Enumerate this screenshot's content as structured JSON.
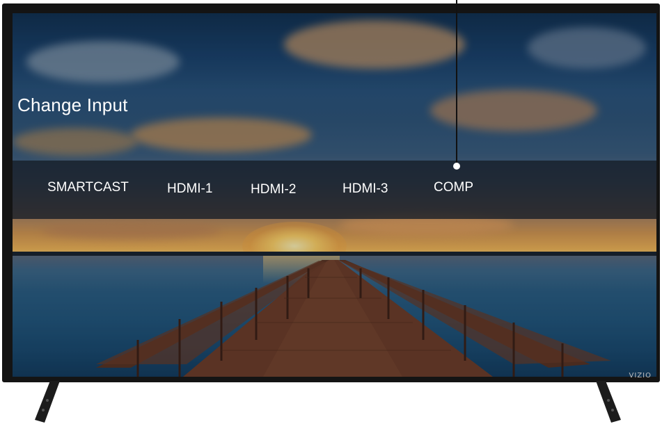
{
  "menu": {
    "title": "Change Input",
    "inputs": [
      {
        "label": "SMARTCAST"
      },
      {
        "label": "HDMI-1"
      },
      {
        "label": "HDMI-2"
      },
      {
        "label": "HDMI-3"
      },
      {
        "label": "COMP"
      }
    ]
  },
  "branding": {
    "logo_text": "VIZIO"
  },
  "colors": {
    "bezel": "#141414",
    "menu_bar": "#141c26",
    "menu_text": "#ffffff",
    "callout_line": "#111111",
    "callout_dot": "#ffffff"
  },
  "annotation": {
    "callout_target": "COMP"
  }
}
